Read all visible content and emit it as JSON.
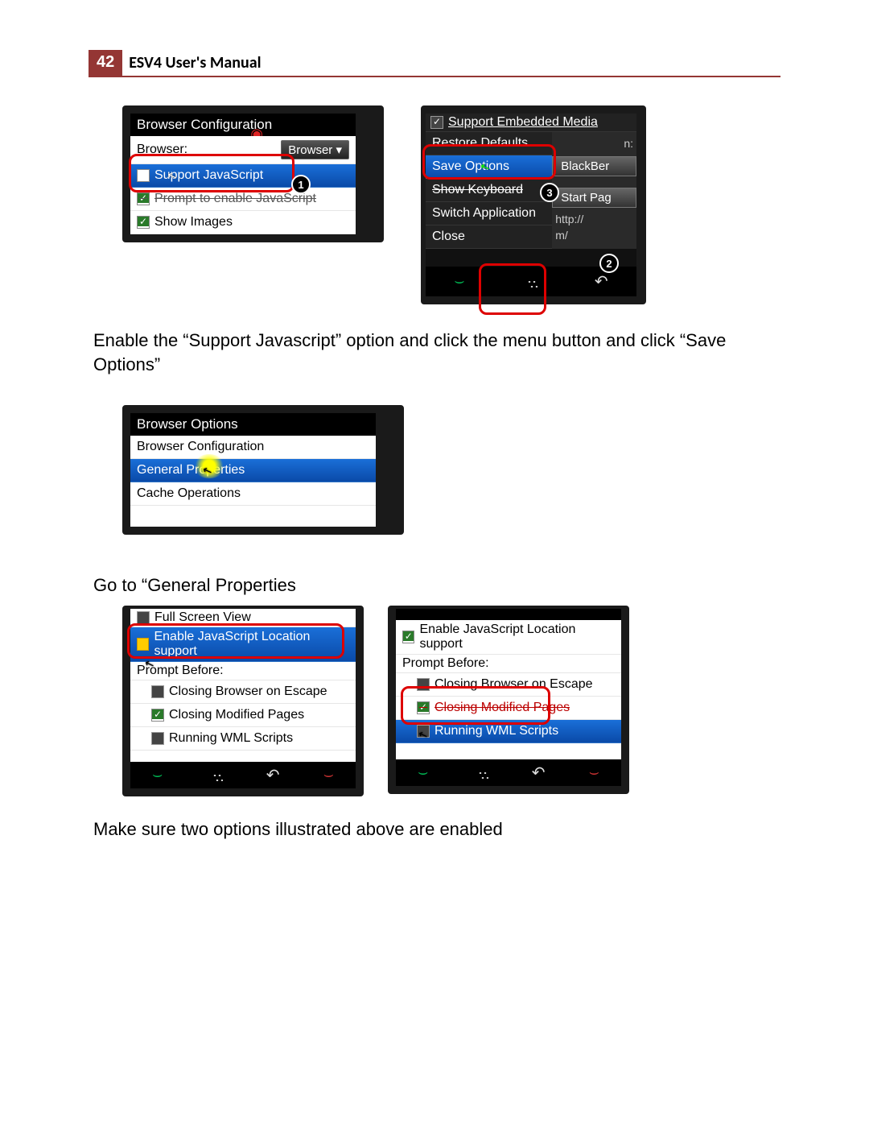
{
  "header": {
    "page_number": "42",
    "title": "ESV4 User's Manual"
  },
  "fig1a": {
    "title": "Browser Configuration",
    "browser_label": "Browser:",
    "browser_dd": "Browser ▾",
    "opt_support_js": "Support JavaScript",
    "opt_prompt_js": "Prompt to enable JavaScript",
    "opt_show_images": "Show Images",
    "note_num": "1"
  },
  "fig1b": {
    "support_media": "Support Embedded Media",
    "restore": "Restore Defaults",
    "save": "Save Options",
    "show_kb": "Show Keyboard",
    "switch_app": "Switch Application",
    "close": "Close",
    "btn_blackber": "BlackBer",
    "btn_startpag": "Start Pag",
    "addr_n": "n:",
    "addr_http": "http://",
    "addr_mn": "m/",
    "note2": "2",
    "note3": "3"
  },
  "para1": "Enable the “Support Javascript” option and click the menu button and click “Save Options”",
  "fig2": {
    "title": "Browser Options",
    "item1": "Browser Configuration",
    "item2": "General Properties",
    "item3": "Cache Operations"
  },
  "para2": "Go to “General Properties",
  "fig3a": {
    "fullscreen": "Full Screen View",
    "enable_js_loc": "Enable JavaScript Location support",
    "prompt_before": "Prompt Before:",
    "close_escape": "Closing Browser on Escape",
    "close_modified": "Closing Modified Pages",
    "run_wml": "Running WML Scripts"
  },
  "fig3b": {
    "enable_js_loc": "Enable JavaScript Location support",
    "prompt_before": "Prompt Before:",
    "close_escape": "Closing Browser on Escape",
    "close_modified": "Closing Modified Pages",
    "run_wml": "Running WML Scripts"
  },
  "para3": "Make sure two options illustrated above are enabled"
}
